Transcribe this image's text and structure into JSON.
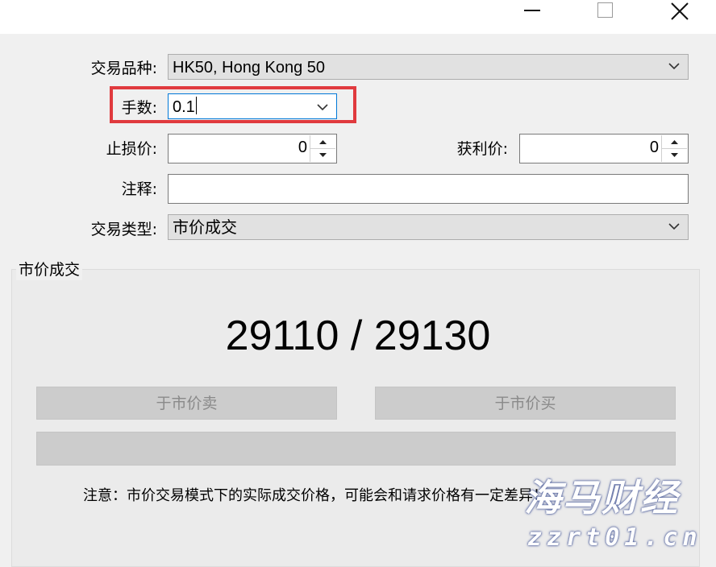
{
  "form": {
    "symbol_label": "交易品种:",
    "symbol_value": "HK50, Hong Kong 50",
    "volume_label": "手数:",
    "volume_value": "0.1",
    "stoploss_label": "止损价:",
    "stoploss_value": "0",
    "takeprofit_label": "获利价:",
    "takeprofit_value": "0",
    "comment_label": "注释:",
    "comment_value": "",
    "type_label": "交易类型:",
    "type_value": "市价成交"
  },
  "market": {
    "group_title": "市价成交",
    "price": "29110 / 29130",
    "sell_label": "于市价卖",
    "buy_label": "于市价买",
    "note": "注意：市价交易模式下的实际成交价格，可能会和请求价格有一定差异！"
  },
  "watermark": {
    "line1": "海马财经",
    "line2": "zzrt01.cn"
  },
  "colors": {
    "highlight": "#e03a3e",
    "background": "#f0f0f0",
    "button_disabled": "#cccccc"
  }
}
